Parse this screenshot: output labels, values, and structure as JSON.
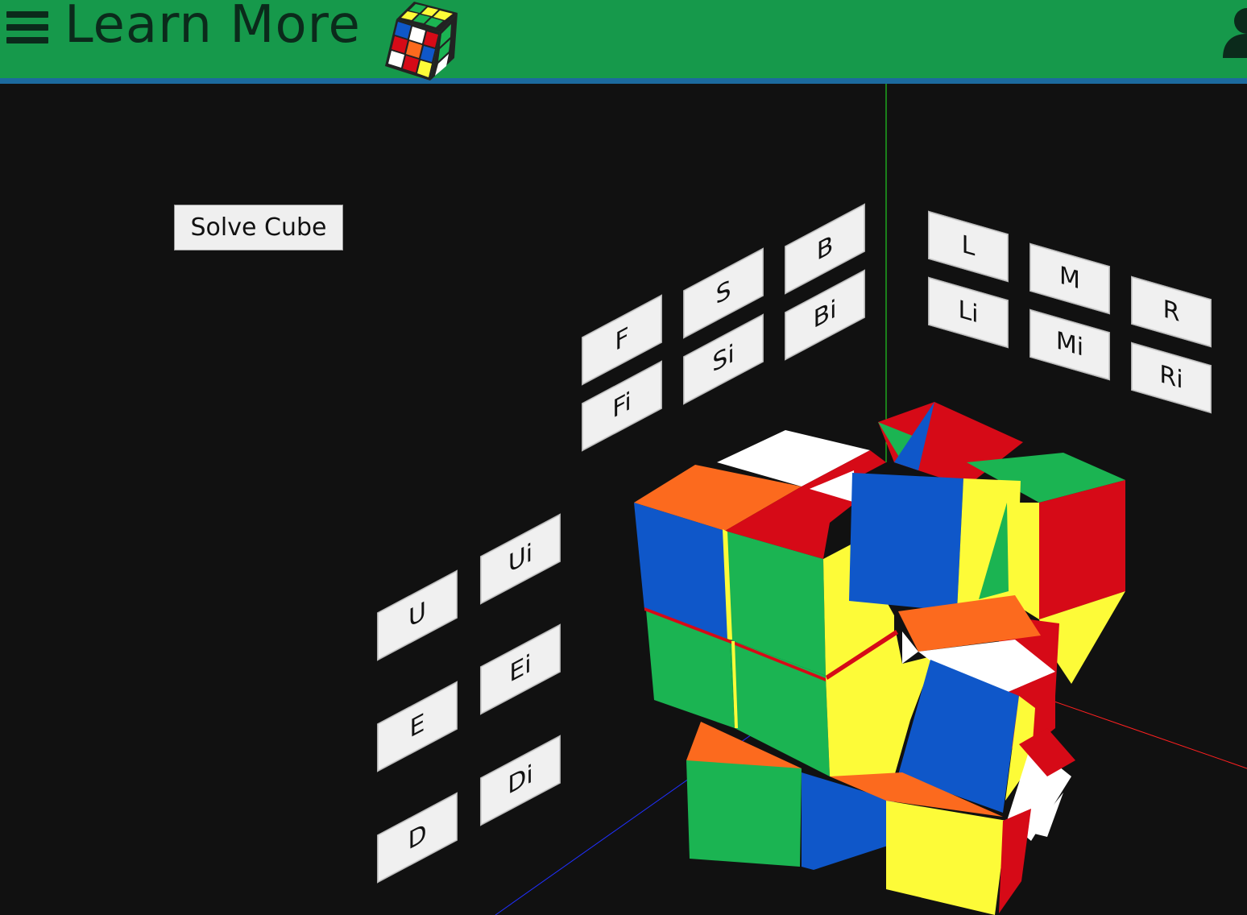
{
  "header": {
    "title": "Learn More",
    "colors": {
      "bar": "#16994b",
      "underline": "#1c6a9e",
      "text": "#0b2a1b"
    }
  },
  "controls": {
    "solve_label": "Solve Cube",
    "moves": {
      "F": "F",
      "S": "S",
      "B": "B",
      "Fi": "Fi",
      "Si": "Si",
      "Bi": "Bi",
      "L": "L",
      "M": "M",
      "R": "R",
      "Li": "Li",
      "Mi": "Mi",
      "Ri": "Ri",
      "U": "U",
      "Ui": "Ui",
      "E": "E",
      "Ei": "Ei",
      "D": "D",
      "Di": "Di"
    }
  },
  "cube_colors": {
    "white": "#ffffff",
    "yellow": "#fdfb38",
    "red": "#d60a17",
    "orange": "#fc6a1e",
    "blue": "#0f57c9",
    "green": "#1bb452"
  },
  "axis_colors": {
    "x": "#ff2020",
    "y": "#22ee22",
    "z": "#2030ff"
  }
}
